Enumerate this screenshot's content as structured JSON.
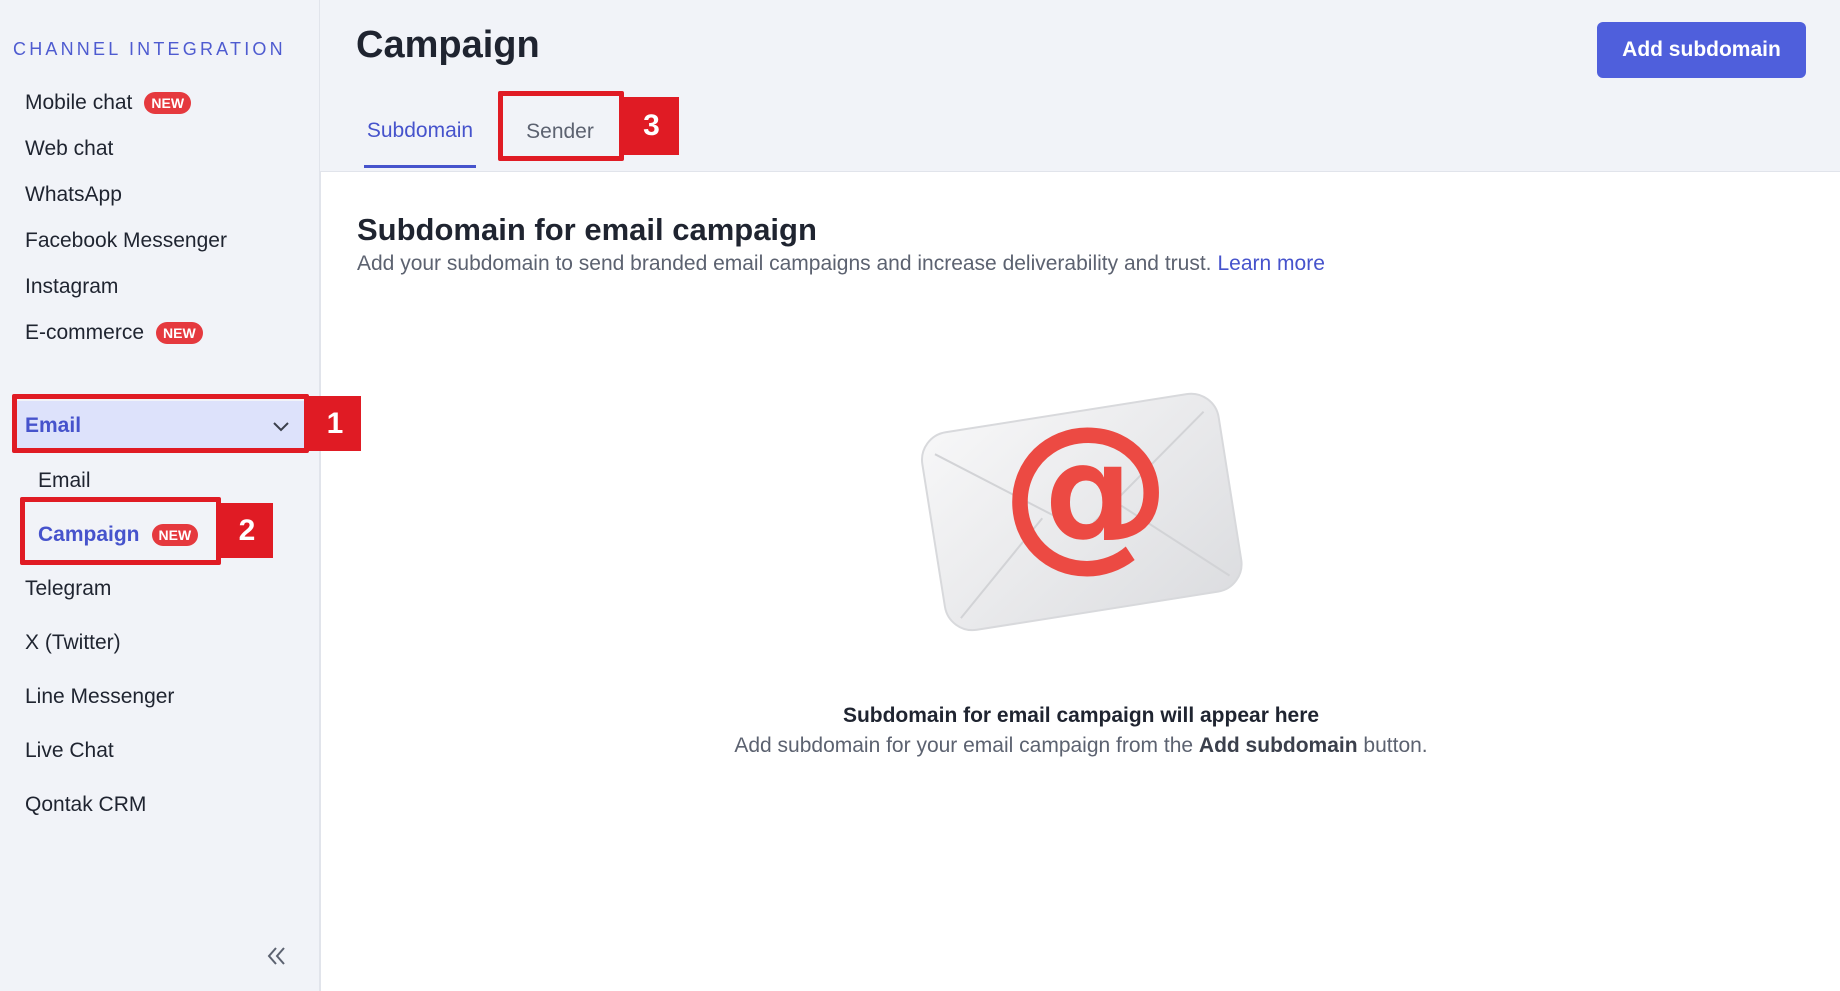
{
  "sidebar": {
    "section_title": "CHANNEL INTEGRATION",
    "items": [
      {
        "label": "Mobile chat",
        "badge": "NEW"
      },
      {
        "label": "Web chat"
      },
      {
        "label": "WhatsApp"
      },
      {
        "label": "Facebook Messenger"
      },
      {
        "label": "Instagram"
      },
      {
        "label": "E-commerce",
        "badge": "NEW"
      },
      {
        "label": "Email",
        "expanded": true,
        "icon": "chevron-down-icon",
        "children": [
          {
            "label": "Email"
          },
          {
            "label": "Campaign",
            "badge": "NEW",
            "active": true
          }
        ]
      },
      {
        "label": "Telegram"
      },
      {
        "label": "X (Twitter)"
      },
      {
        "label": "Line Messenger"
      },
      {
        "label": "Live Chat"
      },
      {
        "label": "Qontak CRM"
      }
    ],
    "collapse_icon": "double-chevron-left-icon"
  },
  "header": {
    "title": "Campaign",
    "add_button": "Add subdomain",
    "tabs": [
      {
        "label": "Subdomain",
        "active": true
      },
      {
        "label": "Sender",
        "active": false
      }
    ]
  },
  "panel": {
    "title": "Subdomain for email campaign",
    "description": "Add your subdomain to send branded email campaigns and increase deliverability and trust.",
    "learn_more": "Learn more",
    "empty_title": "Subdomain for email campaign will appear here",
    "empty_desc_prefix": "Add subdomain for your email campaign from the",
    "empty_desc_bold": "Add subdomain",
    "empty_desc_suffix": "button.",
    "illustration": "envelope-at-icon"
  },
  "annotations": [
    "1",
    "2",
    "3"
  ],
  "colors": {
    "accent": "#4653cc",
    "button": "#4f5fdc",
    "badge": "#e5393e",
    "annotation": "#e01b24"
  }
}
